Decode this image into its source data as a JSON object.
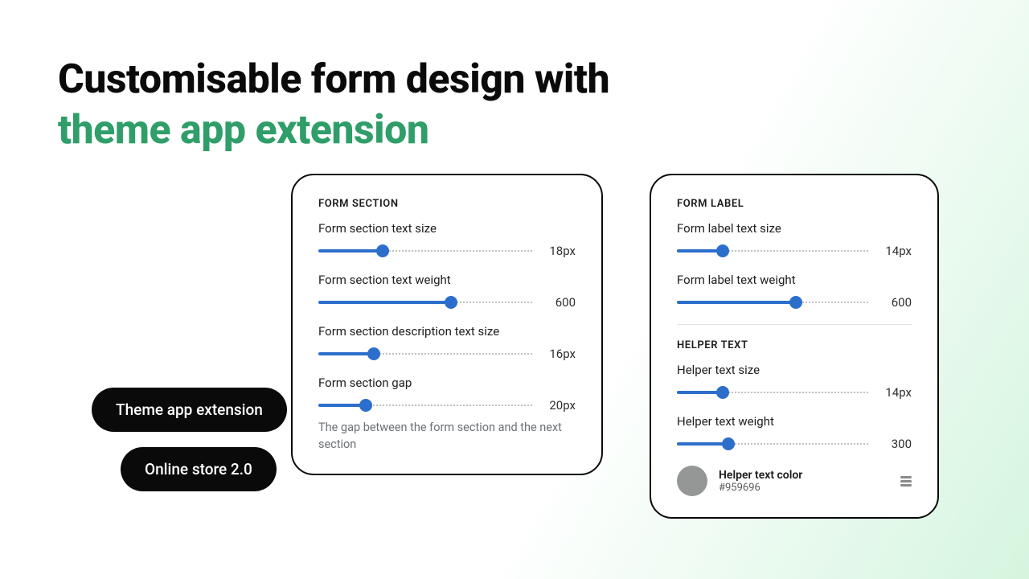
{
  "headline": {
    "line1": "Customisable form design with",
    "line2": "theme app extension"
  },
  "pills": {
    "theme_ext": "Theme app extension",
    "online_store": "Online store 2.0"
  },
  "panel1": {
    "title": "FORM SECTION",
    "controls": [
      {
        "label": "Form section text size",
        "value": "18px",
        "pct": 30
      },
      {
        "label": "Form section text weight",
        "value": "600",
        "pct": 62
      },
      {
        "label": "Form section description text size",
        "value": "16px",
        "pct": 26
      },
      {
        "label": "Form section gap",
        "value": "20px",
        "pct": 22,
        "desc": "The gap between the form section and the next section"
      }
    ]
  },
  "panel2": {
    "group1": {
      "title": "FORM LABEL",
      "controls": [
        {
          "label": "Form label text size",
          "value": "14px",
          "pct": 24
        },
        {
          "label": "Form label text weight",
          "value": "600",
          "pct": 62
        }
      ]
    },
    "group2": {
      "title": "HELPER TEXT",
      "controls": [
        {
          "label": "Helper text size",
          "value": "14px",
          "pct": 24
        },
        {
          "label": "Helper text weight",
          "value": "300",
          "pct": 27
        }
      ],
      "color": {
        "label": "Helper text color",
        "hex": "#959696"
      }
    }
  }
}
